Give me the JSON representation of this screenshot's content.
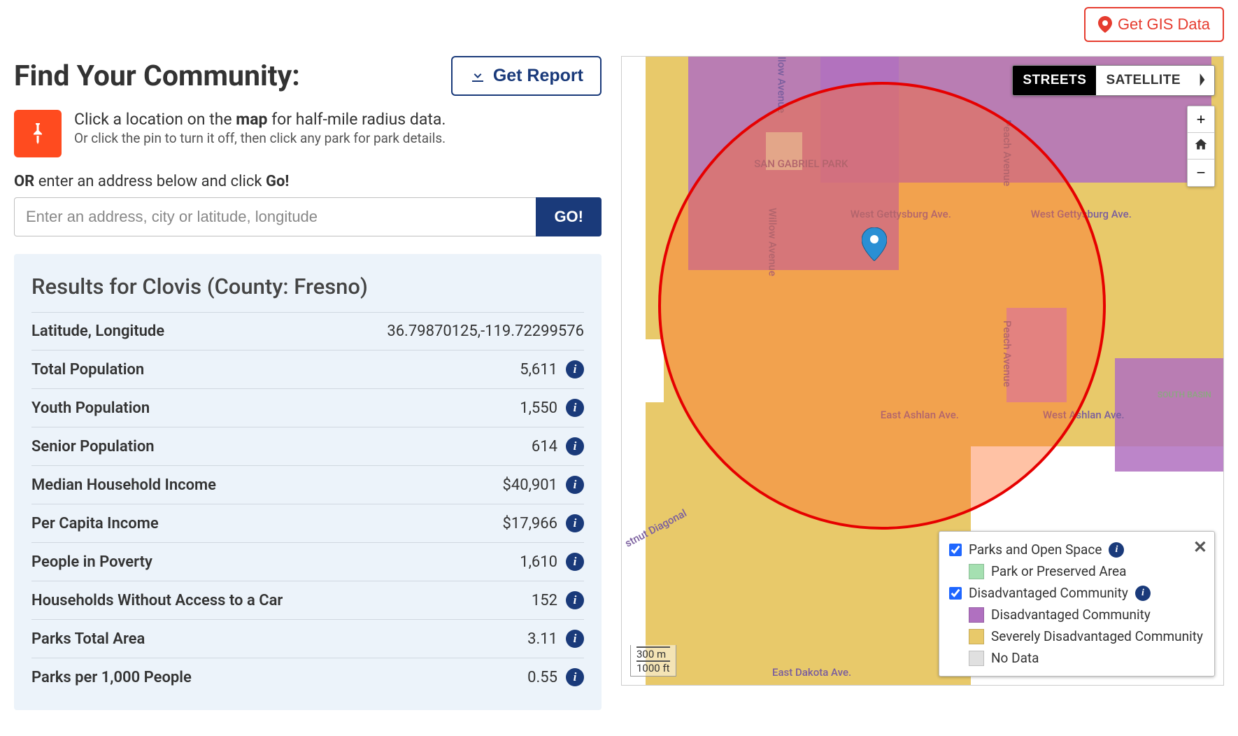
{
  "top": {
    "gis_button": "Get GIS Data"
  },
  "header": {
    "title": "Find Your Community:",
    "report_button": "Get Report"
  },
  "pin": {
    "line1_pre": "Click a location on the ",
    "line1_bold": "map",
    "line1_post": " for half-mile radius data.",
    "line2": "Or click the pin to turn it off, then click any park for park details."
  },
  "search": {
    "or_pre": "OR",
    "or_mid": " enter an address below and click ",
    "or_bold": "Go!",
    "placeholder": "Enter an address, city or latitude, longitude",
    "go": "GO!"
  },
  "results": {
    "title": "Results for Clovis (County: Fresno)",
    "rows": [
      {
        "label": "Latitude, Longitude",
        "value": "36.79870125,-119.72299576",
        "info": false
      },
      {
        "label": "Total Population",
        "value": "5,611",
        "info": true
      },
      {
        "label": "Youth Population",
        "value": "1,550",
        "info": true
      },
      {
        "label": "Senior Population",
        "value": "614",
        "info": true
      },
      {
        "label": "Median Household Income",
        "value": "$40,901",
        "info": true
      },
      {
        "label": "Per Capita Income",
        "value": "$17,966",
        "info": true
      },
      {
        "label": "People in Poverty",
        "value": "1,610",
        "info": true
      },
      {
        "label": "Households Without Access to a Car",
        "value": "152",
        "info": true
      },
      {
        "label": "Parks Total Area",
        "value": "3.11",
        "info": true
      },
      {
        "label": "Parks per 1,000 People",
        "value": "0.55",
        "info": true
      }
    ]
  },
  "map": {
    "streets": "STREETS",
    "satellite": "SATELLITE",
    "labels": {
      "san_gabriel": "SAN GABRIEL PARK",
      "willow": "Willow Avenue",
      "willow2": "llow Avenue",
      "peach": "Peach Avenue",
      "peach2": "Peach Avenue",
      "gettysburg_w": "West Gettysburg Ave.",
      "gettysburg_w2": "West Gettysburg Ave.",
      "ashlan_e": "East Ashlan Ave.",
      "ashlan_w": "West Ashlan Ave.",
      "dakota": "East Dakota Ave.",
      "chestnut": "stnut Diagonal",
      "south_basin": "SOUTH BASIN"
    },
    "scale": {
      "m": "300 m",
      "ft": "1000 ft"
    }
  },
  "legend": {
    "parks_layer": "Parks and Open Space",
    "park_area": "Park or Preserved Area",
    "dac_layer": "Disadvantaged Community",
    "dac": "Disadvantaged Community",
    "sdac": "Severely Disadvantaged Community",
    "nodata": "No Data"
  },
  "colors": {
    "park": "#a5e0b1",
    "dac": "#b070c0",
    "sdac": "#e8c96a",
    "nodata": "#e0e0e0",
    "accent": "#1a3a7a",
    "danger": "#e63c2f"
  }
}
